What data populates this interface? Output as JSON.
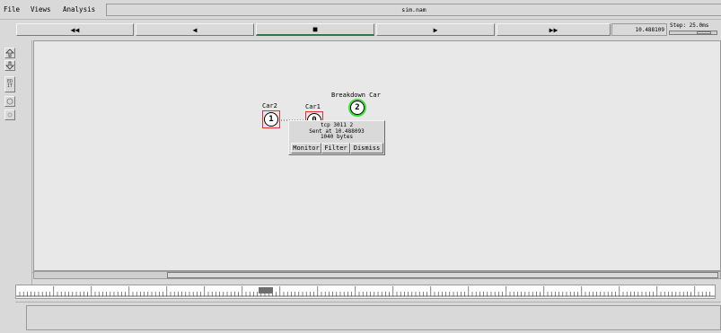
{
  "menu": {
    "file": "File",
    "views": "Views",
    "analysis": "Analysis"
  },
  "window_title": "sim.nam",
  "toolbar": {
    "rewind": "◀◀",
    "back": "◀",
    "stop": "■",
    "play": "▶",
    "fast_forward": "▶▶",
    "time": "10.488109",
    "step_label": "Step: 25.0ms"
  },
  "tools": {
    "edit_label": "ED IT"
  },
  "nodes": [
    {
      "id": "1",
      "label": "Car2"
    },
    {
      "id": "0",
      "label": "Car1"
    },
    {
      "id": "2",
      "label": "Breakdown Car"
    }
  ],
  "popup": {
    "line1": "tcp 3011 2",
    "line2": "Sent at 10.488093",
    "line3": "1040 bytes",
    "monitor": "Monitor",
    "filter": "Filter",
    "dismiss": "Dismiss"
  },
  "colors": {
    "selected": "#e03030",
    "highlight": "#3adf3a",
    "active_button": "#2d7d3a"
  }
}
